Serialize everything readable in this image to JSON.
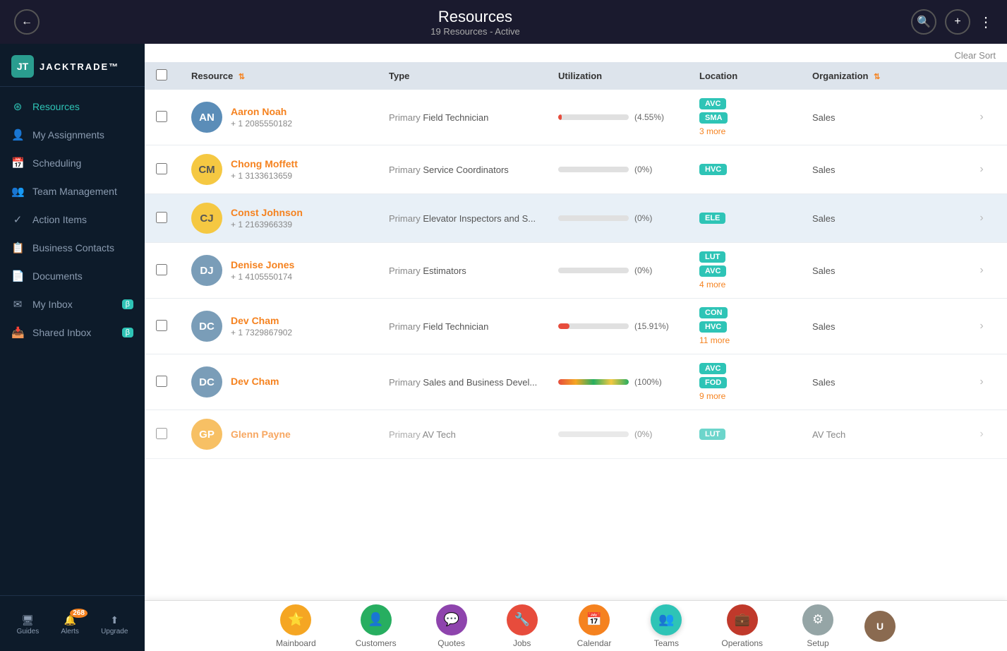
{
  "topbar": {
    "back_label": "←",
    "title": "Resources",
    "subtitle": "19 Resources - Active",
    "search_icon": "search",
    "add_icon": "+",
    "more_icon": "⋮"
  },
  "sidebar": {
    "logo_text": "JACKTRADE™",
    "logo_abbr": "JT",
    "nav_items": [
      {
        "id": "resources",
        "label": "Resources",
        "icon": "⊞",
        "active": true
      },
      {
        "id": "my-assignments",
        "label": "My Assignments",
        "icon": "👤"
      },
      {
        "id": "scheduling",
        "label": "Scheduling",
        "icon": "📅"
      },
      {
        "id": "team-management",
        "label": "Team Management",
        "icon": "👥"
      },
      {
        "id": "action-items",
        "label": "Action Items",
        "icon": "✓"
      },
      {
        "id": "business-contacts",
        "label": "Business Contacts",
        "icon": "📋"
      },
      {
        "id": "documents",
        "label": "Documents",
        "icon": "📄"
      },
      {
        "id": "my-inbox",
        "label": "My Inbox",
        "icon": "✉",
        "badge": "β"
      },
      {
        "id": "shared-inbox",
        "label": "Shared Inbox",
        "icon": "📥",
        "badge": "β"
      }
    ],
    "bottom_items": [
      {
        "id": "guides",
        "label": "Guides",
        "icon": "🖥"
      },
      {
        "id": "alerts",
        "label": "Alerts",
        "icon": "🔔",
        "badge": "268"
      },
      {
        "id": "upgrade",
        "label": "Upgrade",
        "icon": "↑"
      }
    ]
  },
  "table": {
    "clear_sort": "Clear Sort",
    "columns": [
      "",
      "Resource",
      "Type",
      "Utilization",
      "Location",
      "Organization",
      ""
    ],
    "rows": [
      {
        "id": "aaron-noah",
        "name": "Aaron Noah",
        "phone": "+ 1 2085550182",
        "type_prefix": "Primary",
        "type": "Field Technician",
        "util_pct": 4.55,
        "util_label": "(4.55%)",
        "util_color": "low",
        "locations": [
          "AVC",
          "SMA"
        ],
        "more_locations": "3 more",
        "org": "Sales",
        "avatar_type": "photo",
        "avatar_initials": "AN",
        "avatar_bg": "#5b8db8",
        "highlighted": false
      },
      {
        "id": "chong-moffett",
        "name": "Chong Moffett",
        "phone": "+ 1 3133613659",
        "type_prefix": "Primary",
        "type": "Service Coordinators",
        "util_pct": 0,
        "util_label": "(0%)",
        "util_color": "zero",
        "locations": [
          "HVC"
        ],
        "more_locations": "",
        "org": "Sales",
        "avatar_type": "initials",
        "avatar_initials": "CM",
        "avatar_bg": "#f5c842",
        "highlighted": false
      },
      {
        "id": "const-johnson",
        "name": "Const Johnson",
        "phone": "+ 1 2163966339",
        "type_prefix": "Primary",
        "type": "Elevator Inspectors and S...",
        "util_pct": 0,
        "util_label": "(0%)",
        "util_color": "zero",
        "locations": [
          "ELE"
        ],
        "more_locations": "",
        "org": "Sales",
        "avatar_type": "initials",
        "avatar_initials": "CJ",
        "avatar_bg": "#f5c842",
        "highlighted": true
      },
      {
        "id": "denise-jones",
        "name": "Denise Jones",
        "phone": "+ 1 4105550174",
        "type_prefix": "Primary",
        "type": "Estimators",
        "util_pct": 0,
        "util_label": "(0%)",
        "util_color": "zero",
        "locations": [
          "LUT",
          "AVC"
        ],
        "more_locations": "4 more",
        "org": "Sales",
        "avatar_type": "photo",
        "avatar_initials": "DJ",
        "avatar_bg": "#7a9db8",
        "highlighted": false
      },
      {
        "id": "dev-cham-1",
        "name": "Dev Cham",
        "phone": "+ 1 7329867902",
        "type_prefix": "Primary",
        "type": "Field Technician",
        "util_pct": 15.91,
        "util_label": "(15.91%)",
        "util_color": "low",
        "locations": [
          "CON",
          "HVC"
        ],
        "more_locations": "11 more",
        "org": "Sales",
        "avatar_type": "photo",
        "avatar_initials": "DC",
        "avatar_bg": "#7a9db8",
        "highlighted": false
      },
      {
        "id": "dev-cham-2",
        "name": "Dev Cham",
        "phone": "",
        "type_prefix": "Primary",
        "type": "Sales and Business Devel...",
        "util_pct": 100,
        "util_label": "(100%)",
        "util_color": "full",
        "locations": [
          "AVC",
          "FOD"
        ],
        "more_locations": "9 more",
        "org": "Sales",
        "avatar_type": "photo",
        "avatar_initials": "DC",
        "avatar_bg": "#7a9db8",
        "highlighted": false
      },
      {
        "id": "glenn-payne",
        "name": "Glenn Payne",
        "phone": "",
        "type_prefix": "Primary",
        "type": "AV Tech",
        "util_pct": 0,
        "util_label": "(0%)",
        "util_color": "zero",
        "locations": [
          "LUT"
        ],
        "more_locations": "",
        "org": "AV Tech",
        "avatar_type": "initials",
        "avatar_initials": "GP",
        "avatar_bg": "#f5a623",
        "highlighted": false
      }
    ]
  },
  "bottom_nav": {
    "items": [
      {
        "id": "mainboard",
        "label": "Mainboard",
        "icon": "⭐",
        "color": "yellow"
      },
      {
        "id": "customers",
        "label": "Customers",
        "icon": "👤",
        "color": "green"
      },
      {
        "id": "quotes",
        "label": "Quotes",
        "icon": "💬",
        "color": "purple"
      },
      {
        "id": "jobs",
        "label": "Jobs",
        "icon": "🔧",
        "color": "red"
      },
      {
        "id": "calendar",
        "label": "Calendar",
        "icon": "📅",
        "color": "orange"
      },
      {
        "id": "teams",
        "label": "Teams",
        "icon": "👥",
        "color": "teal",
        "active": true
      },
      {
        "id": "operations",
        "label": "Operations",
        "icon": "💼",
        "color": "darkred"
      },
      {
        "id": "setup",
        "label": "Setup",
        "icon": "⚙",
        "color": "gray"
      }
    ]
  }
}
